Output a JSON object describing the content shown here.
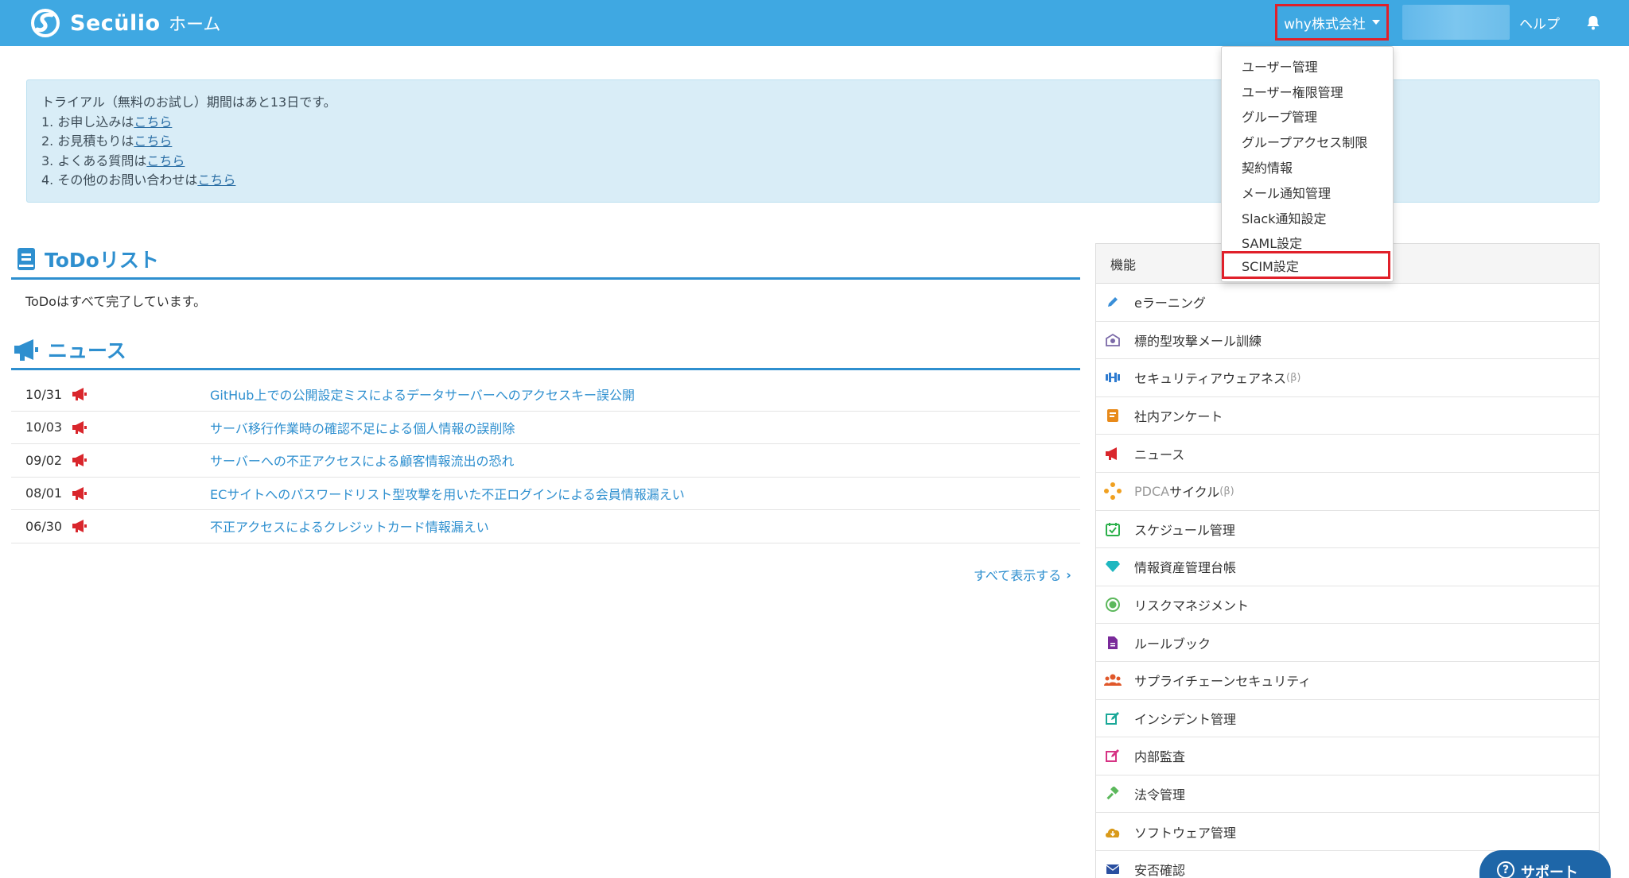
{
  "nav": {
    "brand": "Secülio",
    "home": "ホーム",
    "company": "why株式会社",
    "help": "ヘルプ"
  },
  "alert": {
    "line0": "トライアル（無料のお試し）期間はあと13日です。",
    "items": [
      {
        "prefix": "1. お申し込みは",
        "link": "こちら"
      },
      {
        "prefix": "2. お見積もりは",
        "link": "こちら"
      },
      {
        "prefix": "3. よくある質問は",
        "link": "こちら"
      },
      {
        "prefix": "4. その他のお問い合わせは",
        "link": "こちら"
      }
    ]
  },
  "todo": {
    "title": "ToDoリスト",
    "message": "ToDoはすべて完了しています。"
  },
  "news": {
    "title": "ニュース",
    "items": [
      {
        "date": "10/31",
        "title": "GitHub上での公開設定ミスによるデータサーバーへのアクセスキー誤公開"
      },
      {
        "date": "10/03",
        "title": "サーバ移行作業時の確認不足による個人情報の誤削除"
      },
      {
        "date": "09/02",
        "title": "サーバーへの不正アクセスによる顧客情報流出の恐れ"
      },
      {
        "date": "08/01",
        "title": "ECサイトへのパスワードリスト型攻撃を用いた不正ログインによる会員情報漏えい"
      },
      {
        "date": "06/30",
        "title": "不正アクセスによるクレジットカード情報漏えい"
      }
    ],
    "see_all": "すべて表示する"
  },
  "features": {
    "header": "機能",
    "items": [
      {
        "label": "eラーニング",
        "icon": "pencil-icon",
        "color": "#3a8fd8"
      },
      {
        "label": "標的型攻撃メール訓練",
        "icon": "mail-target-icon",
        "color": "#7b6aa8"
      },
      {
        "label": "セキュリティアウェアネス",
        "beta": "(β)",
        "icon": "dumbbell-icon",
        "color": "#2e7bd0"
      },
      {
        "label": "社内アンケート",
        "icon": "survey-icon",
        "color": "#e88a1a"
      },
      {
        "label": "ニュース",
        "icon": "megaphone-icon",
        "color": "#d9262c"
      },
      {
        "label_thin": "PDCA",
        "label": "サイクル",
        "beta": "(β)",
        "icon": "cycle-icon",
        "color": "#f0a020"
      },
      {
        "label": "スケジュール管理",
        "icon": "calendar-icon",
        "color": "#2bb04a"
      },
      {
        "label": "情報資産管理台帳",
        "icon": "diamond-icon",
        "color": "#1fb7c0"
      },
      {
        "label": "リスクマネジメント",
        "icon": "shield-icon",
        "color": "#5cb85c"
      },
      {
        "label": "ルールブック",
        "icon": "document-icon",
        "color": "#7a2a9a"
      },
      {
        "label": "サプライチェーンセキュリティ",
        "icon": "users-icon",
        "color": "#e0572a"
      },
      {
        "label": "インシデント管理",
        "icon": "edit-icon",
        "color": "#1aa898"
      },
      {
        "label": "内部監査",
        "icon": "edit-pink-icon",
        "color": "#d63384"
      },
      {
        "label": "法令管理",
        "icon": "gavel-icon",
        "color": "#5cb85c"
      },
      {
        "label": "ソフトウェア管理",
        "icon": "cloud-download-icon",
        "color": "#d99a1a"
      },
      {
        "label": "安否確認",
        "icon": "envelope-icon",
        "color": "#2a4fa0"
      }
    ]
  },
  "dropdown": {
    "items": [
      "ユーザー管理",
      "ユーザー権限管理",
      "グループ管理",
      "グループアクセス制限",
      "契約情報",
      "メール通知管理",
      "Slack通知設定",
      "SAML設定"
    ],
    "highlighted": "SCIM設定"
  },
  "support": {
    "label": "サポート"
  },
  "colors": {
    "nav": "#3fa8e2",
    "accent": "#2e8fcf",
    "highlight": "#e0202a",
    "alert_bg": "#d9edf7"
  }
}
